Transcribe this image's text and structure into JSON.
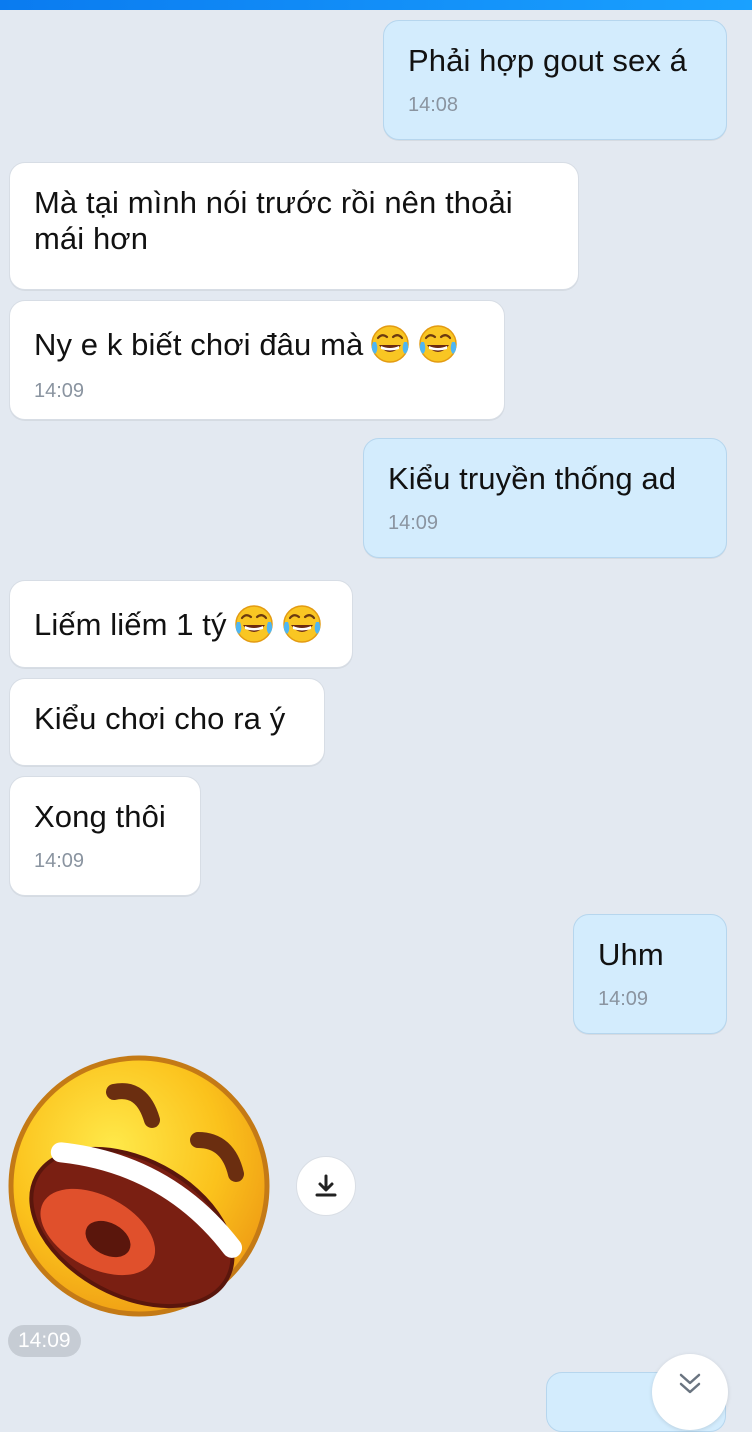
{
  "header": {
    "accent_color": "#1597f8"
  },
  "messages": [
    {
      "side": "out",
      "text": "Phải hợp gout sex á",
      "time": "14:08"
    },
    {
      "side": "in",
      "text": "Mà tại mình nói trước rồi nên thoải\nmái hơn"
    },
    {
      "side": "in",
      "text": "Ny e k biết chơi đâu mà",
      "emoji": "face-with-tears-of-joy",
      "time": "14:09"
    },
    {
      "side": "out",
      "text": "Kiểu truyền thống ad",
      "time": "14:09"
    },
    {
      "side": "in",
      "text": "Liếm liếm 1 tý",
      "emoji": "face-with-tears-of-joy"
    },
    {
      "side": "in",
      "text": "Kiểu chơi cho ra ý"
    },
    {
      "side": "in",
      "text": "Xong thôi",
      "time": "14:09"
    },
    {
      "side": "out",
      "text": "Uhm",
      "time": "14:09"
    }
  ],
  "sticker": {
    "icon": "laughing-face-sticker",
    "time": "14:09",
    "download_icon": "download-icon"
  },
  "scroll_down_icon": "double-chevron-down-icon",
  "colors": {
    "background": "#e3e9f1",
    "incoming_bubble": "#ffffff",
    "outgoing_bubble": "#d3ecfd",
    "time_text": "#8a94a0"
  }
}
